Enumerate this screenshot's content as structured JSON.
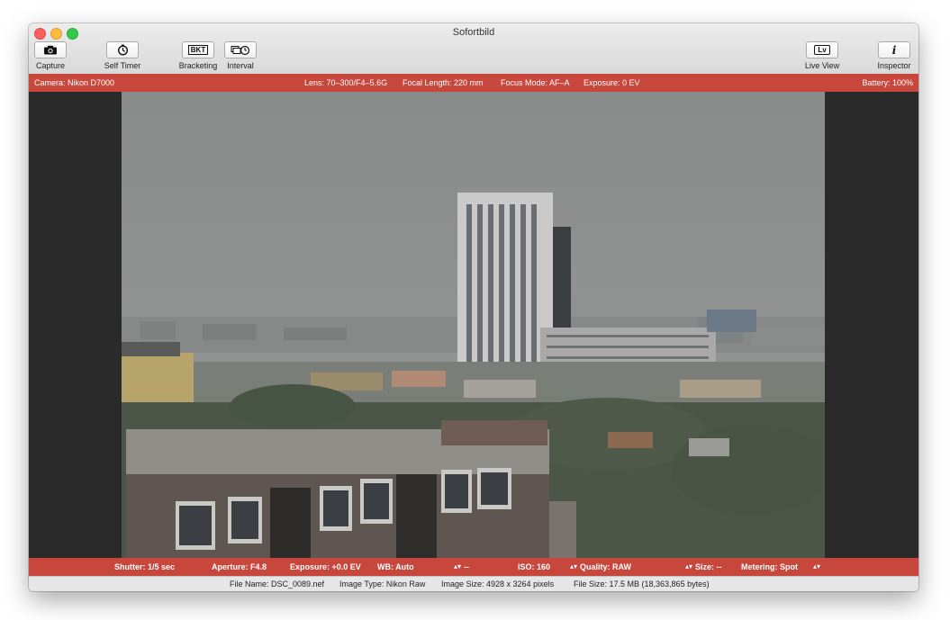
{
  "window": {
    "title": "Sofortbild"
  },
  "toolbar": {
    "capture": {
      "label": "Capture",
      "icon": "camera-icon"
    },
    "self_timer": {
      "label": "Self Timer",
      "icon": "timer-icon"
    },
    "bracketing": {
      "label": "Bracketing",
      "glyph": "BKT"
    },
    "interval": {
      "label": "Interval",
      "icon": "interval-icon"
    },
    "live_view": {
      "label": "Live View",
      "glyph": "Lv"
    },
    "inspector": {
      "label": "Inspector",
      "glyph": "i"
    }
  },
  "info_bar": {
    "camera": "Camera: Nikon D7000",
    "lens": "Lens: 70–300/F4–5.6G",
    "focal_length": "Focal Length: 220 mm",
    "focus_mode": "Focus Mode: AF–A",
    "exposure": "Exposure: 0 EV",
    "battery": "Battery: 100%"
  },
  "controls": {
    "shutter": "Shutter: 1/5 sec",
    "aperture": "Aperture: F4.8",
    "exposure": "Exposure: +0.0 EV",
    "wb": "WB: Auto",
    "wb_detail": "--",
    "iso": "ISO: 160",
    "quality": "Quality: RAW",
    "size": "Size: --",
    "metering": "Metering: Spot"
  },
  "status": {
    "file_name": "File Name: DSC_0089.nef",
    "image_type": "Image Type: Nikon Raw",
    "image_size": "Image Size: 4928 x 3264 pixels",
    "file_size": "File Size: 17.5 MB (18,363,865 bytes)"
  },
  "colors": {
    "accent_bar": "#c8473d",
    "viewer_bg": "#2a2a2a"
  }
}
